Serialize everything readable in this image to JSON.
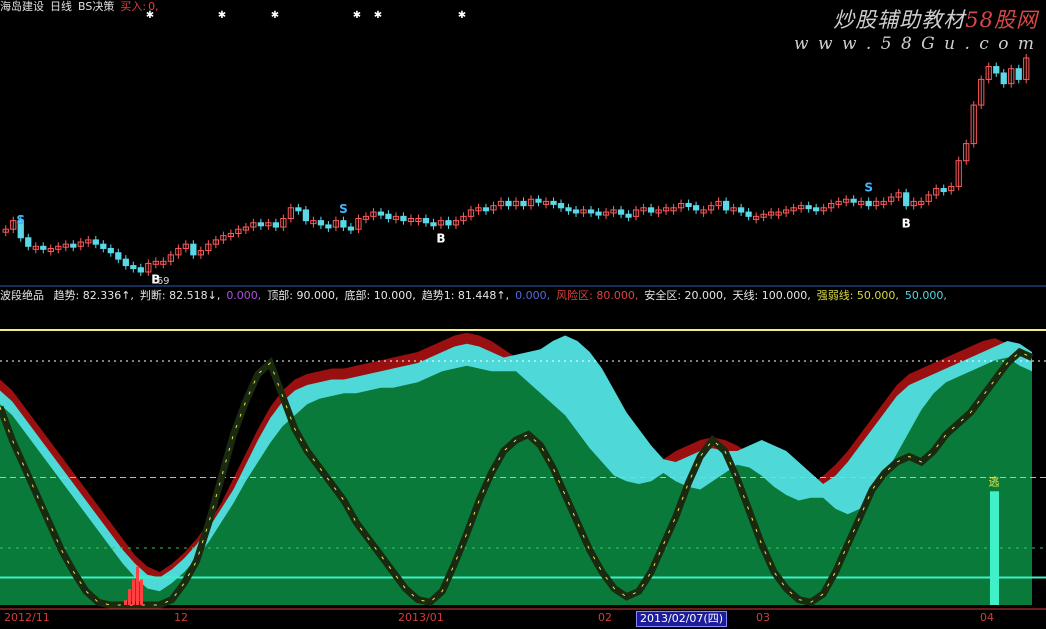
{
  "header": {
    "stock_name": "海岛建设",
    "period": "日线",
    "indicator": "BS决策",
    "signal_label": "买入:",
    "signal_value": "0,"
  },
  "watermark": {
    "title_main": "炒股辅助教材",
    "title_brand": "58股网",
    "url": "w w w . 5 8 G u . c o m"
  },
  "indicator_header": {
    "name": "波段绝品",
    "items": [
      {
        "label": "趋势:",
        "value": "82.336",
        "arrow": "↑",
        "color": "#e6e6e6"
      },
      {
        "label": "判断:",
        "value": "82.518",
        "arrow": "↓",
        "color": "#e6e6e6"
      },
      {
        "label": "",
        "value": "0.000",
        "arrow": "",
        "color": "#b04fe0"
      },
      {
        "label": "顶部:",
        "value": "90.000",
        "arrow": "",
        "color": "#e6e6e6"
      },
      {
        "label": "底部:",
        "value": "10.000",
        "arrow": "",
        "color": "#e6e6e6"
      },
      {
        "label": "趋势1:",
        "value": "81.448",
        "arrow": "↑",
        "color": "#e6e6e6"
      },
      {
        "label": "",
        "value": "0.000",
        "arrow": "",
        "color": "#4f6ae0"
      },
      {
        "label": "风险区:",
        "value": "80.000",
        "arrow": "",
        "color": "#e04040"
      },
      {
        "label": "安全区:",
        "value": "20.000",
        "arrow": "",
        "color": "#e6e6e6"
      },
      {
        "label": "天线:",
        "value": "100.000",
        "arrow": "",
        "color": "#e6e6e6"
      },
      {
        "label": "强弱线:",
        "value": "50.000",
        "arrow": "",
        "color": "#d8d840"
      },
      {
        "label": "",
        "value": "50.000,",
        "arrow": "",
        "color": "#4fd8e0"
      }
    ]
  },
  "candle_markers": {
    "s_label": "S",
    "b_label": "B",
    "low_price": "69",
    "escape_label": "逃"
  },
  "x_axis": {
    "labels": [
      "2012/11",
      "12",
      "2013/01",
      "02",
      "03",
      "04"
    ],
    "selected_date": "2013/02/07(四)"
  },
  "colors": {
    "up_candle": "#ff5a5a",
    "down_candle": "#5ad8e8",
    "fill_green": "#0a7a3a",
    "fill_cyan": "#4fd8d8",
    "fill_red": "#9a1010",
    "upper_line": "#f0f080",
    "bottom_line": "#3ff0c8",
    "mid_line": "#c8c860"
  },
  "chart_data": [
    {
      "type": "candlestick",
      "title": "海岛建设 日线",
      "signals": [
        {
          "bar": 2,
          "label": "S"
        },
        {
          "bar": 45,
          "label": "S"
        },
        {
          "bar": 115,
          "label": "S"
        },
        {
          "bar": 20,
          "label": "B"
        },
        {
          "bar": 58,
          "label": "B"
        },
        {
          "bar": 120,
          "label": "B"
        }
      ],
      "closes": [
        0.2,
        0.24,
        0.16,
        0.12,
        0.12,
        0.11,
        0.11,
        0.12,
        0.13,
        0.12,
        0.14,
        0.15,
        0.13,
        0.11,
        0.09,
        0.06,
        0.03,
        0.02,
        0.0,
        0.04,
        0.05,
        0.05,
        0.08,
        0.11,
        0.13,
        0.08,
        0.1,
        0.13,
        0.15,
        0.17,
        0.18,
        0.2,
        0.21,
        0.23,
        0.22,
        0.23,
        0.21,
        0.25,
        0.3,
        0.29,
        0.24,
        0.24,
        0.22,
        0.21,
        0.24,
        0.21,
        0.2,
        0.25,
        0.26,
        0.28,
        0.27,
        0.25,
        0.26,
        0.24,
        0.25,
        0.25,
        0.23,
        0.22,
        0.24,
        0.22,
        0.24,
        0.26,
        0.29,
        0.3,
        0.29,
        0.31,
        0.33,
        0.31,
        0.33,
        0.31,
        0.34,
        0.33,
        0.33,
        0.32,
        0.3,
        0.29,
        0.28,
        0.29,
        0.28,
        0.27,
        0.28,
        0.29,
        0.27,
        0.26,
        0.29,
        0.3,
        0.28,
        0.29,
        0.3,
        0.3,
        0.32,
        0.31,
        0.29,
        0.29,
        0.31,
        0.33,
        0.29,
        0.3,
        0.28,
        0.26,
        0.26,
        0.27,
        0.28,
        0.28,
        0.29,
        0.3,
        0.31,
        0.3,
        0.29,
        0.3,
        0.32,
        0.33,
        0.34,
        0.33,
        0.33,
        0.31,
        0.33,
        0.33,
        0.35,
        0.37,
        0.31,
        0.33,
        0.33,
        0.36,
        0.39,
        0.38,
        0.4,
        0.52,
        0.6,
        0.78,
        0.9,
        0.96,
        0.93,
        0.88,
        0.95,
        0.9,
        1.0
      ]
    },
    {
      "type": "area",
      "title": "波段绝品",
      "ylim": [
        0,
        100
      ],
      "reference_lines": [
        {
          "name": "天线",
          "value": 100
        },
        {
          "name": "风险区",
          "value": 80
        },
        {
          "name": "强弱线",
          "value": 50
        },
        {
          "name": "安全区",
          "value": 20
        },
        {
          "name": "底部",
          "value": 10
        }
      ],
      "trend": [
        78,
        74,
        68,
        62,
        56,
        50,
        44,
        38,
        32,
        26,
        20,
        15,
        11,
        10,
        13,
        17,
        22,
        28,
        35,
        42,
        50,
        57,
        64,
        70,
        74,
        78,
        80,
        81,
        82,
        82,
        83,
        84,
        84,
        85,
        86,
        88,
        90,
        91,
        92,
        91,
        90,
        90,
        91,
        92,
        93,
        96,
        98,
        96,
        92,
        86,
        78,
        70,
        64,
        58,
        53,
        50,
        48,
        47,
        50,
        53,
        56,
        58,
        60,
        58,
        56,
        52,
        48,
        44,
        40,
        38,
        40,
        46,
        52,
        60,
        68,
        76,
        82,
        86,
        88,
        90,
        92,
        94,
        96,
        95,
        92
      ],
      "judge": [
        82,
        78,
        72,
        66,
        60,
        54,
        48,
        42,
        36,
        30,
        24,
        18,
        14,
        12,
        15,
        19,
        24,
        30,
        37,
        46,
        55,
        64,
        72,
        78,
        82,
        84,
        85,
        86,
        86,
        87,
        88,
        89,
        90,
        91,
        92,
        94,
        96,
        98,
        99,
        98,
        96,
        93,
        90,
        86,
        82,
        78,
        74,
        68,
        62,
        57,
        52,
        50,
        49,
        50,
        53,
        56,
        58,
        60,
        61,
        60,
        58,
        55,
        52,
        48,
        45,
        43,
        44,
        47,
        51,
        56,
        62,
        68,
        74,
        80,
        84,
        86,
        88,
        90,
        92,
        94,
        96,
        97,
        95,
        92,
        90
      ],
      "trend1": [
        72,
        60,
        50,
        40,
        30,
        20,
        12,
        5,
        1,
        0,
        0,
        0,
        0,
        0,
        2,
        8,
        16,
        30,
        46,
        62,
        74,
        84,
        88,
        76,
        64,
        56,
        50,
        44,
        38,
        30,
        24,
        18,
        12,
        6,
        2,
        1,
        5,
        15,
        26,
        38,
        48,
        56,
        60,
        62,
        58,
        50,
        40,
        30,
        20,
        12,
        6,
        3,
        5,
        12,
        22,
        32,
        44,
        54,
        60,
        56,
        46,
        34,
        22,
        12,
        6,
        2,
        1,
        4,
        12,
        22,
        32,
        42,
        48,
        52,
        54,
        52,
        56,
        62,
        66,
        70,
        76,
        82,
        88,
        92,
        90
      ],
      "escape_bar_height": 45,
      "red_volume_bars": [
        3,
        10,
        16,
        24,
        16
      ]
    }
  ]
}
